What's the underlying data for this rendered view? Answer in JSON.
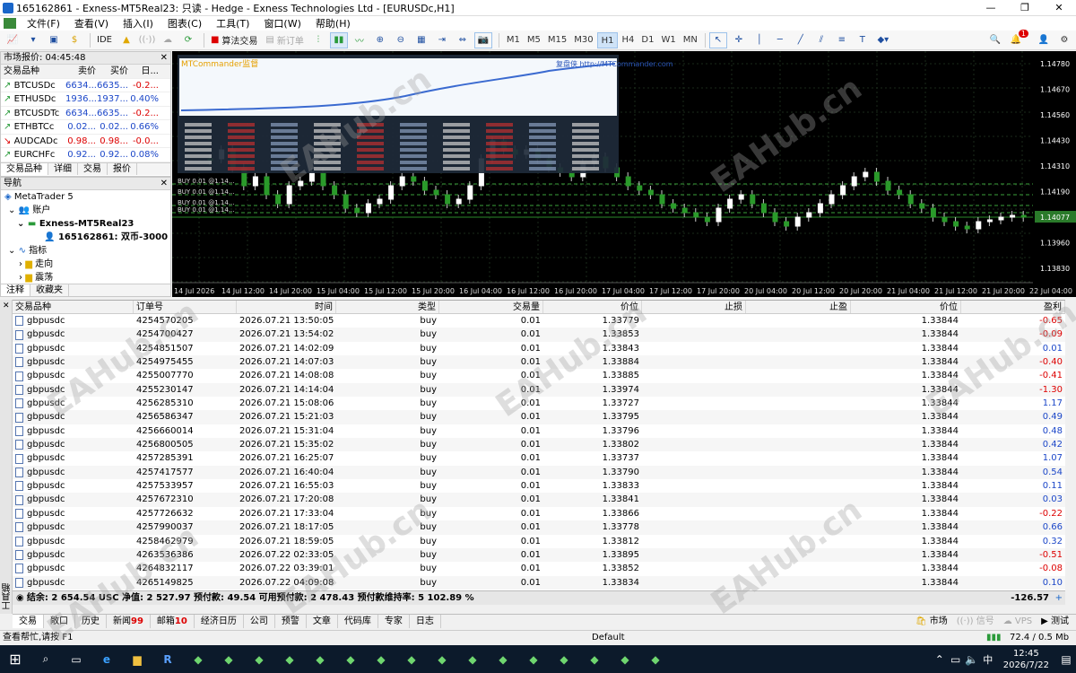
{
  "window": {
    "title": "165162861 - Exness-MT5Real23: 只读 - Hedge - Exness Technologies Ltd - [EURUSDc,H1]",
    "min": "—",
    "max": "❐",
    "close": "✕"
  },
  "menu": [
    "文件(F)",
    "查看(V)",
    "插入(I)",
    "图表(C)",
    "工具(T)",
    "窗口(W)",
    "帮助(H)"
  ],
  "toolbar": {
    "algo": "算法交易",
    "new_order": "新订单",
    "ide": "IDE",
    "timeframes": [
      "M1",
      "M5",
      "M15",
      "M30",
      "H1",
      "H4",
      "D1",
      "W1",
      "MN"
    ],
    "selected_tf": "H1",
    "notify_count": "1"
  },
  "market_watch": {
    "title": "市场报价: 04:45:48",
    "headers": [
      "交易品种",
      "卖价",
      "买价",
      "日..."
    ],
    "rows": [
      {
        "sym": "BTCUSDc",
        "bid": "6634...",
        "ask": "6635...",
        "chg": "-0.2...",
        "dir": "up"
      },
      {
        "sym": "ETHUSDc",
        "bid": "1936...",
        "ask": "1937...",
        "chg": "0.40%",
        "dir": "up"
      },
      {
        "sym": "BTCUSDTc",
        "bid": "6634...",
        "ask": "6635...",
        "chg": "-0.2...",
        "dir": "up"
      },
      {
        "sym": "ETHBTCc",
        "bid": "0.02...",
        "ask": "0.02...",
        "chg": "0.66%",
        "dir": "up"
      },
      {
        "sym": "AUDCADc",
        "bid": "0.98...",
        "ask": "0.98...",
        "chg": "-0.0...",
        "dir": "down"
      },
      {
        "sym": "EURCHFc",
        "bid": "0.92...",
        "ask": "0.92...",
        "chg": "0.08%",
        "dir": "up"
      }
    ],
    "tabs": [
      "交易品种",
      "详细",
      "交易",
      "报价"
    ]
  },
  "navigator": {
    "title": "导航",
    "items": [
      "MetaTrader 5",
      "账户",
      "Exness-MT5Real23",
      "165162861: 双币-3000",
      "指标",
      "走向",
      "震荡"
    ],
    "tabs": [
      "注释",
      "收藏夹"
    ]
  },
  "chart": {
    "symbol": "EURUSDc,H1",
    "overlay_title": "MTCommander监督",
    "overlay_link": "复盘侠 http://MTCommander.com",
    "price_labels": [
      "1.14780",
      "1.14670",
      "1.14560",
      "1.14430",
      "1.14310",
      "1.14190",
      "1.14077",
      "1.13960",
      "1.13830"
    ],
    "current_price": "1.14077",
    "time_labels": [
      "14 Jul 2026",
      "14 Jul 12:00",
      "14 Jul 20:00",
      "15 Jul 04:00",
      "15 Jul 12:00",
      "15 Jul 20:00",
      "16 Jul 04:00",
      "16 Jul 12:00",
      "16 Jul 20:00",
      "17 Jul 04:00",
      "17 Jul 12:00",
      "17 Jul 20:00",
      "20 Jul 04:00",
      "20 Jul 12:00",
      "20 Jul 20:00",
      "21 Jul 04:00",
      "21 Jul 12:00",
      "21 Jul 20:00",
      "22 Jul 04:00"
    ],
    "buy_labels": [
      "BUY 0.01 @1.14...",
      "BUY 0.01 @1.14...",
      "BUY 0.01 @1.14...",
      "BUY 0.01 @1.14..."
    ]
  },
  "trade_table": {
    "headers": [
      "交易品种",
      "订单号",
      "时间",
      "类型",
      "交易量",
      "价位",
      "止损",
      "止盈",
      "价位",
      "盈利"
    ],
    "rows": [
      [
        "gbpusdc",
        "4254570205",
        "2026.07.21 13:50:05",
        "buy",
        "0.01",
        "1.33779",
        "",
        "",
        "1.33844",
        "-0.65"
      ],
      [
        "gbpusdc",
        "4254700427",
        "2026.07.21 13:54:02",
        "buy",
        "0.01",
        "1.33853",
        "",
        "",
        "1.33844",
        "-0.09"
      ],
      [
        "gbpusdc",
        "4254851507",
        "2026.07.21 14:02:09",
        "buy",
        "0.01",
        "1.33843",
        "",
        "",
        "1.33844",
        "0.01"
      ],
      [
        "gbpusdc",
        "4254975455",
        "2026.07.21 14:07:03",
        "buy",
        "0.01",
        "1.33884",
        "",
        "",
        "1.33844",
        "-0.40"
      ],
      [
        "gbpusdc",
        "4255007770",
        "2026.07.21 14:08:08",
        "buy",
        "0.01",
        "1.33885",
        "",
        "",
        "1.33844",
        "-0.41"
      ],
      [
        "gbpusdc",
        "4255230147",
        "2026.07.21 14:14:04",
        "buy",
        "0.01",
        "1.33974",
        "",
        "",
        "1.33844",
        "-1.30"
      ],
      [
        "gbpusdc",
        "4256285310",
        "2026.07.21 15:08:06",
        "buy",
        "0.01",
        "1.33727",
        "",
        "",
        "1.33844",
        "1.17"
      ],
      [
        "gbpusdc",
        "4256586347",
        "2026.07.21 15:21:03",
        "buy",
        "0.01",
        "1.33795",
        "",
        "",
        "1.33844",
        "0.49"
      ],
      [
        "gbpusdc",
        "4256660014",
        "2026.07.21 15:31:04",
        "buy",
        "0.01",
        "1.33796",
        "",
        "",
        "1.33844",
        "0.48"
      ],
      [
        "gbpusdc",
        "4256800505",
        "2026.07.21 15:35:02",
        "buy",
        "0.01",
        "1.33802",
        "",
        "",
        "1.33844",
        "0.42"
      ],
      [
        "gbpusdc",
        "4257285391",
        "2026.07.21 16:25:07",
        "buy",
        "0.01",
        "1.33737",
        "",
        "",
        "1.33844",
        "1.07"
      ],
      [
        "gbpusdc",
        "4257417577",
        "2026.07.21 16:40:04",
        "buy",
        "0.01",
        "1.33790",
        "",
        "",
        "1.33844",
        "0.54"
      ],
      [
        "gbpusdc",
        "4257533957",
        "2026.07.21 16:55:03",
        "buy",
        "0.01",
        "1.33833",
        "",
        "",
        "1.33844",
        "0.11"
      ],
      [
        "gbpusdc",
        "4257672310",
        "2026.07.21 17:20:08",
        "buy",
        "0.01",
        "1.33841",
        "",
        "",
        "1.33844",
        "0.03"
      ],
      [
        "gbpusdc",
        "4257726632",
        "2026.07.21 17:33:04",
        "buy",
        "0.01",
        "1.33866",
        "",
        "",
        "1.33844",
        "-0.22"
      ],
      [
        "gbpusdc",
        "4257990037",
        "2026.07.21 18:17:05",
        "buy",
        "0.01",
        "1.33778",
        "",
        "",
        "1.33844",
        "0.66"
      ],
      [
        "gbpusdc",
        "4258462979",
        "2026.07.21 18:59:05",
        "buy",
        "0.01",
        "1.33812",
        "",
        "",
        "1.33844",
        "0.32"
      ],
      [
        "gbpusdc",
        "4263536386",
        "2026.07.22 02:33:05",
        "buy",
        "0.01",
        "1.33895",
        "",
        "",
        "1.33844",
        "-0.51"
      ],
      [
        "gbpusdc",
        "4264832117",
        "2026.07.22 03:39:01",
        "buy",
        "0.01",
        "1.33852",
        "",
        "",
        "1.33844",
        "-0.08"
      ],
      [
        "gbpusdc",
        "4265149825",
        "2026.07.22 04:09:08",
        "buy",
        "0.01",
        "1.33834",
        "",
        "",
        "1.33844",
        "0.10"
      ]
    ]
  },
  "summary": {
    "text": "结余: 2 654.54 USC  净值: 2 527.97  预付款: 49.54  可用预付款: 2 478.43  预付款维持率: 5 102.89 %",
    "profit": "-126.57"
  },
  "bottom_tabs": [
    {
      "label": "交易"
    },
    {
      "label": "敞口"
    },
    {
      "label": "历史"
    },
    {
      "label": "新闻",
      "count": "99"
    },
    {
      "label": "邮箱",
      "count": "10"
    },
    {
      "label": "经济日历"
    },
    {
      "label": "公司"
    },
    {
      "label": "预警"
    },
    {
      "label": "文章"
    },
    {
      "label": "代码库"
    },
    {
      "label": "专家"
    },
    {
      "label": "日志"
    }
  ],
  "bottom_right": [
    "市场",
    "信号",
    "VPS",
    "测试"
  ],
  "toolbox_label": "工具箱",
  "status": {
    "help": "查看帮忙,请按 F1",
    "profile": "Default",
    "net": "72.4 / 0.5 Mb"
  },
  "taskbar": {
    "time": "12:45",
    "date": "2026/7/22"
  },
  "watermark": "EAHub.cn"
}
